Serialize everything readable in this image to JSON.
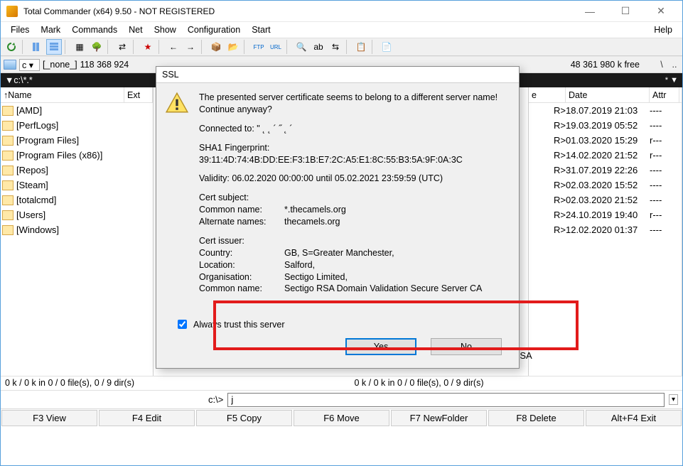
{
  "window": {
    "title": "Total Commander (x64) 9.50 - NOT REGISTERED"
  },
  "menu": {
    "items": [
      "Files",
      "Mark",
      "Commands",
      "Net",
      "Show",
      "Configuration",
      "Start"
    ],
    "help": "Help"
  },
  "drive": {
    "letter": "c",
    "label": "[_none_]",
    "left_info": "118 368 924",
    "right_info": "48 361 980 k free",
    "nav1": "\\",
    "nav2": ".."
  },
  "path": {
    "left": "c:\\*.*",
    "right": ""
  },
  "cols": {
    "name": "Name",
    "ext": "Ext",
    "size": "e",
    "date": "Date",
    "attr": "Attr",
    "uparrow": "↑"
  },
  "left_list": [
    "[AMD]",
    "[PerfLogs]",
    "[Program Files]",
    "[Program Files (x86)]",
    "[Repos]",
    "[Steam]",
    "[totalcmd]",
    "[Users]",
    "[Windows]"
  ],
  "right_rows": [
    {
      "size": "R>",
      "date": "18.07.2019 21:03",
      "attr": "----"
    },
    {
      "size": "R>",
      "date": "19.03.2019 05:52",
      "attr": "----"
    },
    {
      "size": "R>",
      "date": "01.03.2020 15:29",
      "attr": "r---"
    },
    {
      "size": "R>",
      "date": "14.02.2020 21:52",
      "attr": "r---"
    },
    {
      "size": "R>",
      "date": "31.07.2019 22:26",
      "attr": "----"
    },
    {
      "size": "R>",
      "date": "02.03.2020 15:52",
      "attr": "----"
    },
    {
      "size": "R>",
      "date": "02.03.2020 21:52",
      "attr": "----"
    },
    {
      "size": "R>",
      "date": "24.10.2019 19:40",
      "attr": "r---"
    },
    {
      "size": "R>",
      "date": "12.02.2020 01:37",
      "attr": "----"
    }
  ],
  "right_peek": {
    "text": "RSA"
  },
  "status": {
    "left": "0 k / 0 k in 0 / 0 file(s), 0 / 9 dir(s)",
    "right": "0 k / 0 k in 0 / 0 file(s), 0 / 9 dir(s)"
  },
  "cmd": {
    "prompt": "c:\\>",
    "value": "j"
  },
  "fkeys": [
    "F3 View",
    "F4 Edit",
    "F5 Copy",
    "F6 Move",
    "F7 NewFolder",
    "F8 Delete",
    "Alt+F4 Exit"
  ],
  "dialog": {
    "title": "SSL",
    "l1": "The presented server certificate seems to belong to a different server name!",
    "l2": "Continue anyway?",
    "connected_lbl": "Connected to: \"",
    "connected_val": " ˛  ˛  ´     ˝    ˛  ´",
    "sha_lbl": "SHA1 Fingerprint:",
    "sha_val": "39:11:4D:74:4B:DD:EE:F3:1B:E7:2C:A5:E1:8C:55:B3:5A:9F:0A:3C",
    "val_lbl": "Validity: 06.02.2020 00:00:00 until 05.02.2021 23:59:59 (UTC)",
    "subj": "Cert subject:",
    "cn_lbl": "Common name:",
    "cn_val": "*.thecamels.org",
    "alt_lbl": "Alternate names:",
    "alt_val": "thecamels.org",
    "iss": "Cert issuer:",
    "country_lbl": "Country:",
    "country_val": "GB, S=Greater Manchester,",
    "loc_lbl": "Location:",
    "loc_val": "Salford,",
    "org_lbl": "Organisation:",
    "org_val": "Sectigo Limited,",
    "cn2_lbl": "Common name:",
    "cn2_val": "Sectigo RSA Domain Validation Secure Server CA",
    "trust": "Always trust this server",
    "yes": "Yes",
    "no": "No"
  }
}
